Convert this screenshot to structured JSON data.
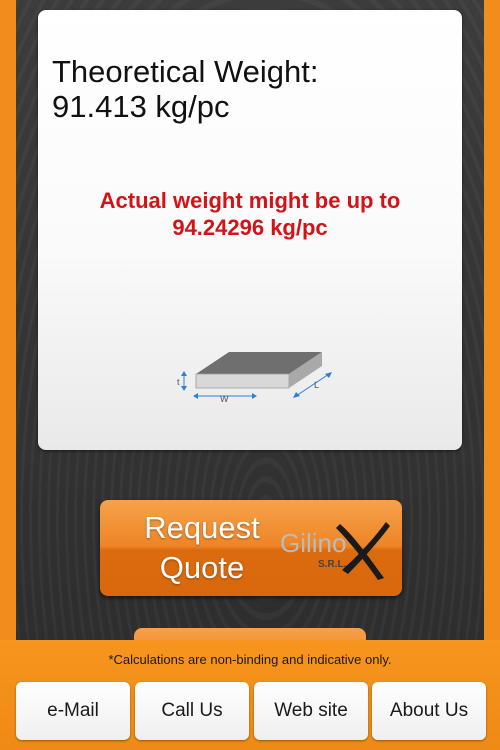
{
  "result": {
    "theoretical_label": "Theoretical Weight:",
    "theoretical_value": "91.413 kg/pc",
    "actual_line1": "Actual weight might be up to",
    "actual_line2": "94.24296 kg/pc"
  },
  "diagram": {
    "icon": "flat-bar-diagram-icon",
    "dim_t": "t",
    "dim_w": "W",
    "dim_l": "L"
  },
  "quote_button": {
    "line1": "Request",
    "line2": "Quote"
  },
  "logo": {
    "word": "Gilino",
    "suffix": "S.R.L."
  },
  "footer": {
    "disclaimer": "*Calculations are non-binding and indicative only.",
    "nav": [
      "e-Mail",
      "Call Us",
      "Web site",
      "About Us"
    ]
  },
  "colors": {
    "accent_orange": "#f28c1c",
    "warning_red": "#d21418",
    "background_dark": "#333333"
  }
}
